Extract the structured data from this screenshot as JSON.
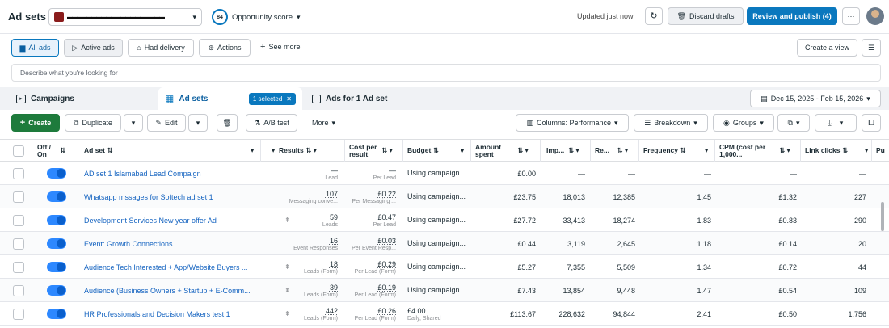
{
  "header": {
    "title": "Ad sets",
    "account_name": "▬▬▬▬▬▬▬▬▬▬▬▬▬▬▬▬▬▬▬▬",
    "opportunity_badge": "84",
    "opportunity_label": "Opportunity score",
    "updated_text": "Updated just now",
    "discard_label": "Discard drafts",
    "publish_label": "Review and publish (4)",
    "more_label": "···"
  },
  "filters": {
    "all_ads": "All ads",
    "active_ads": "Active ads",
    "had_delivery": "Had delivery",
    "actions": "Actions",
    "see_more": "See more",
    "create_view": "Create a view"
  },
  "search": {
    "placeholder": "Describe what you're looking for"
  },
  "tabs": {
    "campaigns": "Campaigns",
    "ad_sets": "Ad sets",
    "selected_badge": "1 selected",
    "ads_for": "Ads for 1 Ad set"
  },
  "date_range": "Dec 15, 2025 - Feb 15, 2026",
  "toolbar": {
    "create": "Create",
    "duplicate": "Duplicate",
    "edit": "Edit",
    "ab_test": "A/B test",
    "more": "More",
    "columns": "Columns: Performance",
    "breakdown": "Breakdown",
    "groups": "Groups"
  },
  "columns": {
    "off_on": "Off / On",
    "ad_set": "Ad set",
    "results": "Results",
    "cost_per_result": "Cost per result",
    "budget": "Budget",
    "amount_spent": "Amount spent",
    "impressions": "Imp...",
    "reach": "Re...",
    "frequency": "Frequency",
    "cpm": "CPM (cost per 1,000...",
    "link_clicks": "Link clicks",
    "partial": "Pu"
  },
  "rows": [
    {
      "name": "AD set 1 Islamabad Lead Compaign",
      "results": "—",
      "results_sub": "Lead",
      "cost": "—",
      "cost_sub": "Per Lead",
      "budget": "Using campaign...",
      "budget_sub": "",
      "spent": "£0.00",
      "imp": "—",
      "reach": "—",
      "freq": "—",
      "cpm": "—",
      "clicks": "—"
    },
    {
      "name": "Whatsapp mssages for Softech ad set 1",
      "results": "107",
      "results_sub": "Messaging conve...",
      "cost": "£0.22",
      "cost_sub": "Per Messaging ...",
      "budget": "Using campaign...",
      "budget_sub": "",
      "spent": "£23.75",
      "imp": "18,013",
      "reach": "12,385",
      "freq": "1.45",
      "cpm": "£1.32",
      "clicks": "227"
    },
    {
      "name": "Development Services New year offer Ad",
      "results": "59",
      "results_sub": "Leads",
      "cost": "£0.47",
      "cost_sub": "Per Lead",
      "budget": "Using campaign...",
      "budget_sub": "",
      "spent": "£27.72",
      "imp": "33,413",
      "reach": "18,274",
      "freq": "1.83",
      "cpm": "£0.83",
      "clicks": "290"
    },
    {
      "name": "Event: Growth Connections",
      "results": "16",
      "results_sub": "Event Responses",
      "cost": "£0.03",
      "cost_sub": "Per Event Resp...",
      "budget": "Using campaign...",
      "budget_sub": "",
      "spent": "£0.44",
      "imp": "3,119",
      "reach": "2,645",
      "freq": "1.18",
      "cpm": "£0.14",
      "clicks": "20"
    },
    {
      "name": "Audience Tech Interested + App/Website Buyers ...",
      "results": "18",
      "results_sub": "Leads (Form)",
      "cost": "£0.29",
      "cost_sub": "Per Lead (Form)",
      "budget": "Using campaign...",
      "budget_sub": "",
      "spent": "£5.27",
      "imp": "7,355",
      "reach": "5,509",
      "freq": "1.34",
      "cpm": "£0.72",
      "clicks": "44"
    },
    {
      "name": "Audience (Business Owners + Startup + E-Comm...",
      "results": "39",
      "results_sub": "Leads (Form)",
      "cost": "£0.19",
      "cost_sub": "Per Lead (Form)",
      "budget": "Using campaign...",
      "budget_sub": "",
      "spent": "£7.43",
      "imp": "13,854",
      "reach": "9,448",
      "freq": "1.47",
      "cpm": "£0.54",
      "clicks": "109"
    },
    {
      "name": "HR Professionals and Decision Makers test 1",
      "results": "442",
      "results_sub": "Leads (Form)",
      "cost": "£0.26",
      "cost_sub": "Per Lead (Form)",
      "budget": "£4.00",
      "budget_sub": "Daily, Shared",
      "spent": "£113.67",
      "imp": "228,632",
      "reach": "94,844",
      "freq": "2.41",
      "cpm": "£0.50",
      "clicks": "1,756"
    }
  ],
  "colors": {
    "accent": "#0a78be",
    "create": "#1e7b3c",
    "link": "#1463c0",
    "toggle": "#2d88ff"
  }
}
